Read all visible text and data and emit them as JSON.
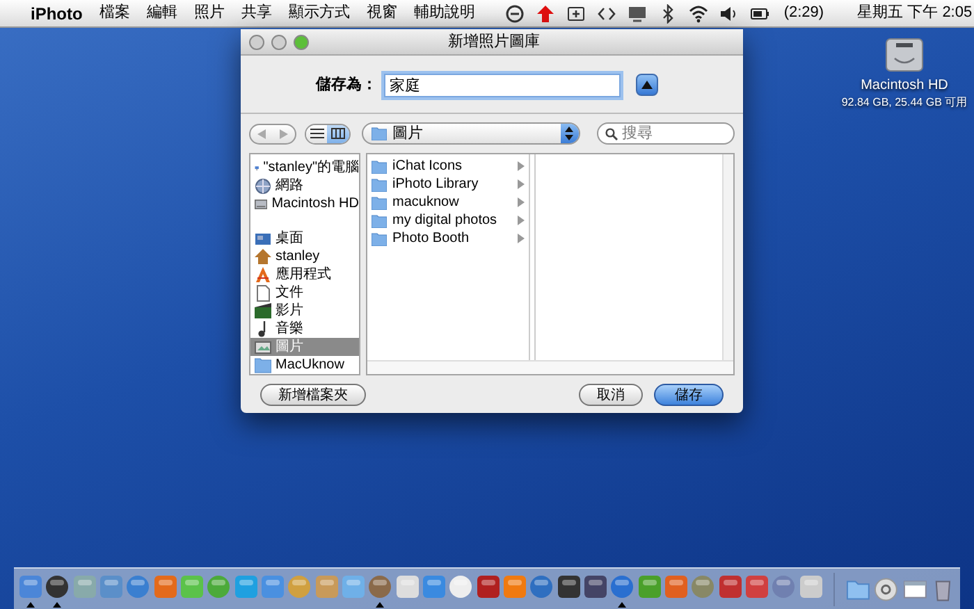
{
  "menubar": {
    "app": "iPhoto",
    "menus": [
      "檔案",
      "編輯",
      "照片",
      "共享",
      "顯示方式",
      "視窗",
      "輔助說明"
    ],
    "battery_time": "(2:29)",
    "clock": "星期五 下午 2:05"
  },
  "desktop_icon": {
    "label": "Macintosh HD",
    "info": "92.84 GB, 25.44 GB 可用"
  },
  "dialog": {
    "title": "新增照片圖庫",
    "save_as_label": "儲存為：",
    "save_as_value": "家庭",
    "location": "圖片",
    "search_placeholder": "搜尋",
    "view_modes": [
      {
        "selected": false
      },
      {
        "selected": true
      }
    ],
    "sidebar": {
      "devices": [
        {
          "label": "\"stanley\"的電腦",
          "selected": false
        },
        {
          "label": "網路",
          "selected": false
        },
        {
          "label": "Macintosh HD",
          "selected": false
        }
      ],
      "places": [
        {
          "label": "桌面",
          "selected": false
        },
        {
          "label": "stanley",
          "selected": false
        },
        {
          "label": "應用程式",
          "selected": false
        },
        {
          "label": "文件",
          "selected": false
        },
        {
          "label": "影片",
          "selected": false
        },
        {
          "label": "音樂",
          "selected": false
        },
        {
          "label": "圖片",
          "selected": true
        },
        {
          "label": "MacUknow",
          "selected": false
        }
      ]
    },
    "column_1": [
      {
        "label": "iChat Icons"
      },
      {
        "label": "iPhoto Library"
      },
      {
        "label": "macuknow"
      },
      {
        "label": "my digital photos"
      },
      {
        "label": "Photo Booth"
      }
    ],
    "new_folder_button": "新增檔案夾",
    "cancel_button": "取消",
    "save_button": "儲存"
  },
  "dock": {
    "apps": [
      {
        "running": true
      },
      {
        "running": true
      },
      {
        "running": false
      },
      {
        "running": false
      },
      {
        "running": false
      },
      {
        "running": false
      },
      {
        "running": false
      },
      {
        "running": false
      },
      {
        "running": false
      },
      {
        "running": false
      },
      {
        "running": false
      },
      {
        "running": false
      },
      {
        "running": false
      },
      {
        "running": true
      },
      {
        "running": false
      },
      {
        "running": false
      },
      {
        "running": false
      },
      {
        "running": false
      },
      {
        "running": false
      },
      {
        "running": false
      },
      {
        "running": false
      },
      {
        "running": false
      },
      {
        "running": true
      },
      {
        "running": false
      },
      {
        "running": false
      },
      {
        "running": false
      },
      {
        "running": false
      },
      {
        "running": false
      },
      {
        "running": false
      },
      {
        "running": false
      }
    ]
  }
}
